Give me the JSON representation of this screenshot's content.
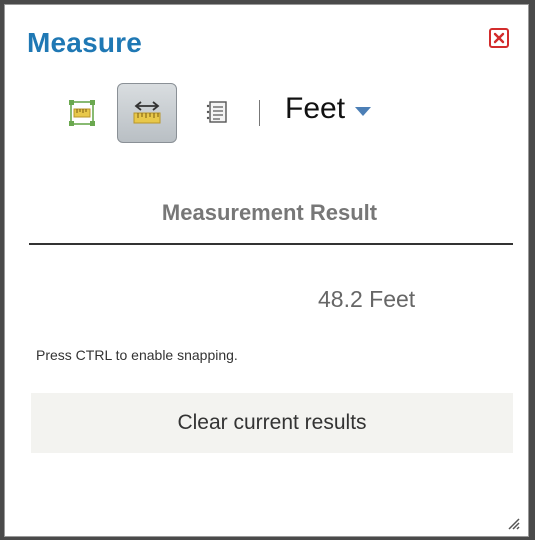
{
  "widget": {
    "title": "Measure",
    "close_icon": "close-icon"
  },
  "toolbar": {
    "tools": [
      {
        "name": "area",
        "icon": "area-measure-icon",
        "active": false
      },
      {
        "name": "distance",
        "icon": "distance-measure-icon",
        "active": true
      },
      {
        "name": "location",
        "icon": "location-measure-icon",
        "active": false
      }
    ],
    "units_selected": "Feet",
    "units_caret_icon": "chevron-down-icon"
  },
  "result": {
    "header": "Measurement Result",
    "value": "48.2 Feet",
    "hint": "Press CTRL to enable snapping."
  },
  "actions": {
    "clear_label": "Clear current results"
  },
  "colors": {
    "title": "#1f78b4",
    "close": "#d32c2c",
    "caret": "#4c7fb6"
  }
}
